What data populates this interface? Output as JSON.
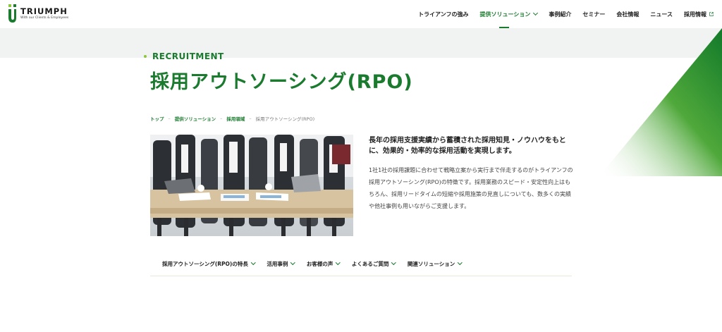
{
  "header": {
    "logo": {
      "name": "TRIUMPH",
      "tagline": "With our Clients & Employees"
    },
    "nav": [
      {
        "label": "トライアンフの強み",
        "dropdown": false,
        "active": false
      },
      {
        "label": "提供ソリューション",
        "dropdown": true,
        "active": true
      },
      {
        "label": "事例紹介",
        "dropdown": false,
        "active": false
      },
      {
        "label": "セミナー",
        "dropdown": false,
        "active": false
      },
      {
        "label": "会社情報",
        "dropdown": false,
        "active": false
      },
      {
        "label": "ニュース",
        "dropdown": false,
        "active": false
      },
      {
        "label": "採用情報",
        "dropdown": false,
        "active": false,
        "external": true
      }
    ]
  },
  "hero": {
    "eyebrow": "RECRUITMENT",
    "title": "採用アウトソーシング(RPO)"
  },
  "breadcrumb": [
    {
      "label": "トップ",
      "link": true
    },
    {
      "label": "提供ソリューション",
      "link": true
    },
    {
      "label": "採用領域",
      "link": true
    },
    {
      "label": "採用アウトソーシング(RPO)",
      "link": false
    }
  ],
  "intro": {
    "lead": "長年の採用支援実績から蓄積された採用知見・ノウハウをもとに、効果的・効率的な採用活動を実現します。",
    "body": "1社1社の採用課題に合わせて戦略立案から実行まで伴走するのがトライアンフの採用アウトソーシング(RPO)の特徴です。採用業務のスピード・安定性向上はもちろん、採用リードタイムの短縮や採用施策の見直しについても、数多くの実績や他社事例も用いながらご支援します。"
  },
  "subnav": [
    {
      "label": "採用アウトソーシング(RPO)の特長"
    },
    {
      "label": "活用事例"
    },
    {
      "label": "お客様の声"
    },
    {
      "label": "よくあるご質問"
    },
    {
      "label": "関連ソリューション"
    }
  ],
  "colors": {
    "brand_green": "#1a7a2e",
    "accent_lime": "#8cc63f",
    "band_gray": "#f1f2f2"
  }
}
